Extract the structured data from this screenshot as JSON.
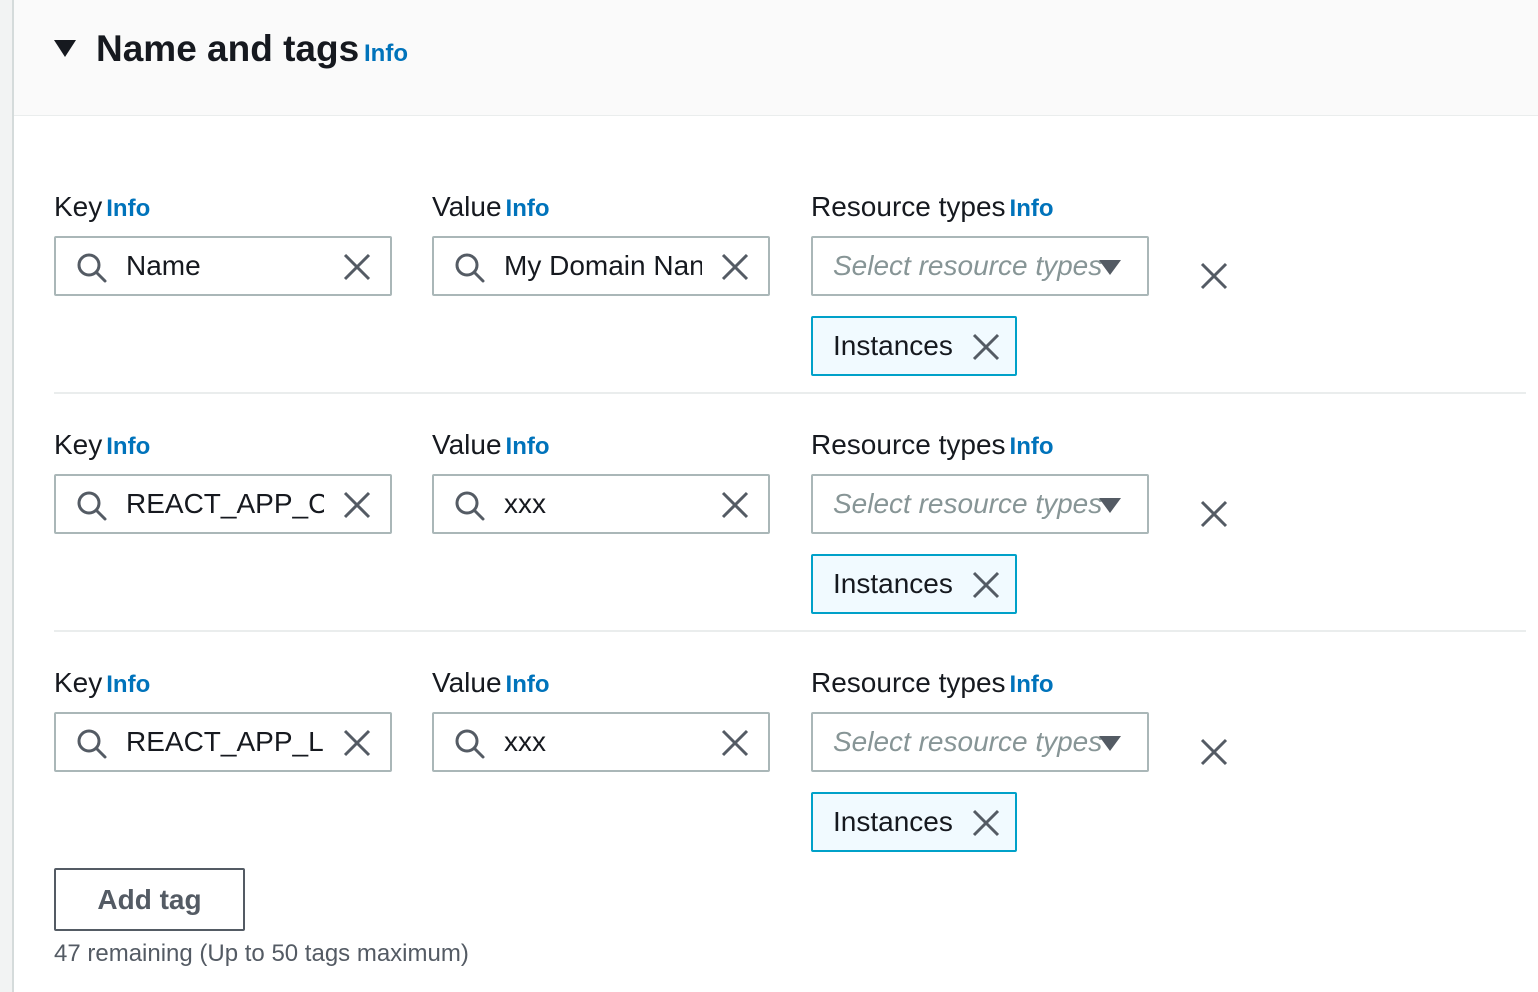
{
  "panel": {
    "title": "Name and tags",
    "info": "Info"
  },
  "labels": {
    "key": "Key",
    "value": "Value",
    "resource_types": "Resource types",
    "info": "Info"
  },
  "select_placeholder": "Select resource types",
  "tags": [
    {
      "key": "Name",
      "value": "My Domain Nan",
      "resource_token": "Instances"
    },
    {
      "key": "REACT_APP_CLI",
      "value": "xxx",
      "resource_token": "Instances"
    },
    {
      "key": "REACT_APP_LIC",
      "value": "xxx",
      "resource_token": "Instances"
    }
  ],
  "add_tag_label": "Add tag",
  "remaining_text": "47 remaining (Up to 50 tags maximum)",
  "colors": {
    "link": "#0073bb",
    "token_border": "#00a1c9",
    "input_border": "#aab7b8"
  }
}
